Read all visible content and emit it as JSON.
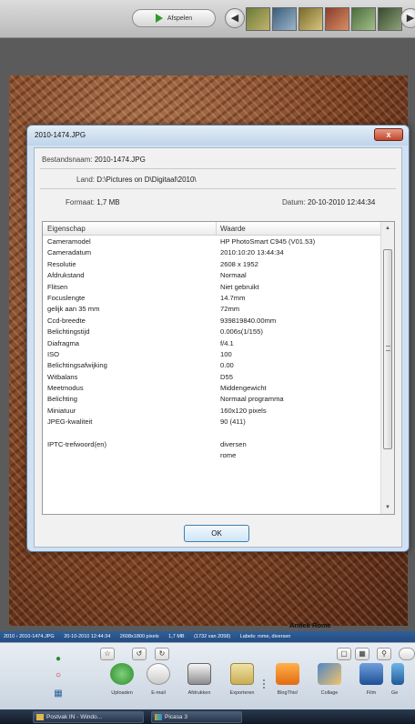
{
  "toolbar": {
    "play_label": "Afspelen",
    "prev_icon": "arrow-left-icon",
    "next_icon": "arrow-right-icon"
  },
  "dialog": {
    "title": "2010-1474.JPG",
    "close_label": "x",
    "filename_label": "Bestandsnaam:",
    "filename_value": "2010-1474.JPG",
    "location_label": "Land:",
    "location_value": "D:\\Pictures on D\\Digitaal\\2010\\",
    "size_label": "Formaat:",
    "size_value": "1,7 MB",
    "date_label": "Datum:",
    "date_value": "20-10-2010 12:44:34",
    "col_property": "Eigenschap",
    "col_value": "Waarde",
    "rows": [
      {
        "p": "Cameramodel",
        "v": "HP PhotoSmart C945 (V01.53)"
      },
      {
        "p": "Cameradatum",
        "v": "2010:10:20 13:44:34"
      },
      {
        "p": "Resolutie",
        "v": "2608 x 1952"
      },
      {
        "p": "Afdrukstand",
        "v": "Normaal"
      },
      {
        "p": "Flitsen",
        "v": "Niet gebruikt"
      },
      {
        "p": "Focuslengte",
        "v": "14.7mm"
      },
      {
        "p": "gelijk aan 35 mm",
        "v": "72mm"
      },
      {
        "p": "Ccd-breedte",
        "v": "939819840.00mm"
      },
      {
        "p": "Belichtingstijd",
        "v": "0.006s(1/155)"
      },
      {
        "p": "Diafragma",
        "v": "f/4.1"
      },
      {
        "p": "ISO",
        "v": "100"
      },
      {
        "p": "Belichtingsafwijking",
        "v": "0.00"
      },
      {
        "p": "Witbalans",
        "v": "D55"
      },
      {
        "p": "Meetmodus",
        "v": "Middengewicht"
      },
      {
        "p": "Belichting",
        "v": "Normaal programma"
      },
      {
        "p": "Miniatuur",
        "v": "160x120 pixels"
      },
      {
        "p": "JPEG-kwaliteit",
        "v": "90 (411)"
      },
      {
        "p": "",
        "v": ""
      },
      {
        "p": "IPTC-trefwoord(en)",
        "v": "diversen"
      },
      {
        "p": "",
        "v": "rome"
      }
    ],
    "ok_label": "OK"
  },
  "caption": "Antiek Rome",
  "statusbar": {
    "path": "2010 › 2010-1474.JPG",
    "date": "20-10-2010 12:44:34",
    "dims": "2608x1800 pixels",
    "size": "1,7 MB",
    "count": "(1732 van 2058)",
    "labels": "Labels: rome, diversen"
  },
  "tray": {
    "tools": [
      "Uploaden",
      "E-mail",
      "Afdrukken",
      "Exporteren",
      "BlogThis!",
      "Collage",
      "Film",
      "Ge"
    ]
  },
  "taskbar": {
    "task1": "Postvak IN - Windo...",
    "task2": "Picasa 3"
  },
  "colors": {
    "dialog_frame": "#cfe1f2",
    "close_red": "#c2452b",
    "status_blue": "#2f5f9b",
    "play_green": "#2f9a2b"
  }
}
